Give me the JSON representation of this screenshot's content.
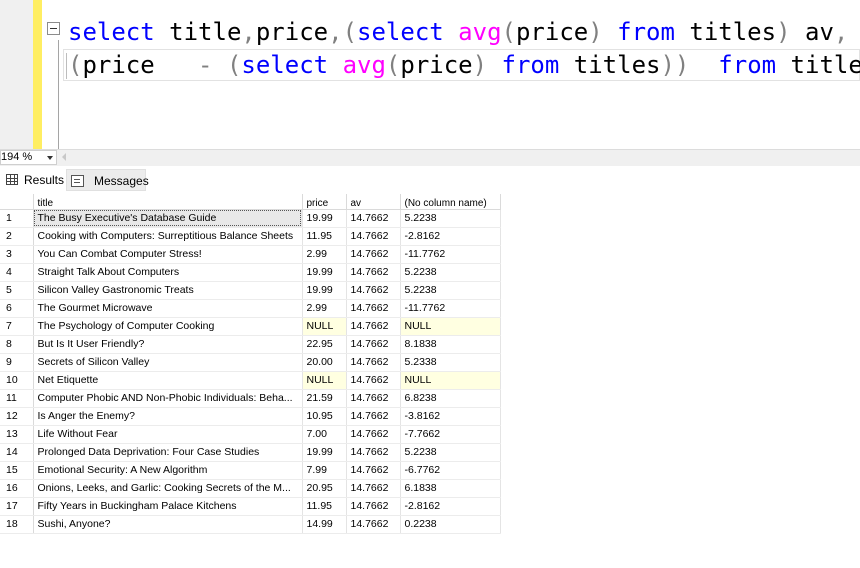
{
  "editor": {
    "line1": [
      {
        "t": "select",
        "c": "kw"
      },
      {
        "t": " title",
        "c": ""
      },
      {
        "t": ",",
        "c": "op"
      },
      {
        "t": "price",
        "c": ""
      },
      {
        "t": ",",
        "c": "op"
      },
      {
        "t": "(",
        "c": "op"
      },
      {
        "t": "select",
        "c": "kw"
      },
      {
        "t": " ",
        "c": ""
      },
      {
        "t": "avg",
        "c": "fn"
      },
      {
        "t": "(",
        "c": "op"
      },
      {
        "t": "price",
        "c": ""
      },
      {
        "t": ")",
        "c": "op"
      },
      {
        "t": " ",
        "c": ""
      },
      {
        "t": "from",
        "c": "kw"
      },
      {
        "t": " titles",
        "c": ""
      },
      {
        "t": ")",
        "c": "op"
      },
      {
        "t": " av",
        "c": ""
      },
      {
        "t": ",",
        "c": "op"
      }
    ],
    "line2": [
      {
        "t": "(",
        "c": "op"
      },
      {
        "t": "price   ",
        "c": ""
      },
      {
        "t": "-",
        "c": "op"
      },
      {
        "t": " ",
        "c": ""
      },
      {
        "t": "(",
        "c": "op"
      },
      {
        "t": "select",
        "c": "kw"
      },
      {
        "t": " ",
        "c": ""
      },
      {
        "t": "avg",
        "c": "fn"
      },
      {
        "t": "(",
        "c": "op"
      },
      {
        "t": "price",
        "c": ""
      },
      {
        "t": ")",
        "c": "op"
      },
      {
        "t": " ",
        "c": ""
      },
      {
        "t": "from",
        "c": "kw"
      },
      {
        "t": " titles",
        "c": ""
      },
      {
        "t": "))",
        "c": "op"
      },
      {
        "t": "  ",
        "c": ""
      },
      {
        "t": "from",
        "c": "kw"
      },
      {
        "t": " titles",
        "c": ""
      }
    ]
  },
  "zoom": {
    "value": "194 %"
  },
  "tabs": {
    "results": "Results",
    "messages": "Messages"
  },
  "grid": {
    "columns": [
      "title",
      "price",
      "av",
      "(No column name)"
    ],
    "rows": [
      [
        "1",
        "The Busy Executive's Database Guide",
        "19.99",
        "14.7662",
        "5.2238"
      ],
      [
        "2",
        "Cooking with Computers: Surreptitious Balance Sheets",
        "11.95",
        "14.7662",
        "-2.8162"
      ],
      [
        "3",
        "You Can Combat Computer Stress!",
        "2.99",
        "14.7662",
        "-11.7762"
      ],
      [
        "4",
        "Straight Talk About Computers",
        "19.99",
        "14.7662",
        "5.2238"
      ],
      [
        "5",
        "Silicon Valley Gastronomic Treats",
        "19.99",
        "14.7662",
        "5.2238"
      ],
      [
        "6",
        "The Gourmet Microwave",
        "2.99",
        "14.7662",
        "-11.7762"
      ],
      [
        "7",
        "The Psychology of Computer Cooking",
        "NULL",
        "14.7662",
        "NULL"
      ],
      [
        "8",
        "But Is It User Friendly?",
        "22.95",
        "14.7662",
        "8.1838"
      ],
      [
        "9",
        "Secrets of Silicon Valley",
        "20.00",
        "14.7662",
        "5.2338"
      ],
      [
        "10",
        "Net Etiquette",
        "NULL",
        "14.7662",
        "NULL"
      ],
      [
        "11",
        "Computer Phobic AND Non-Phobic Individuals: Beha...",
        "21.59",
        "14.7662",
        "6.8238"
      ],
      [
        "12",
        "Is Anger the Enemy?",
        "10.95",
        "14.7662",
        "-3.8162"
      ],
      [
        "13",
        "Life Without Fear",
        "7.00",
        "14.7662",
        "-7.7662"
      ],
      [
        "14",
        "Prolonged Data Deprivation: Four Case Studies",
        "19.99",
        "14.7662",
        "5.2238"
      ],
      [
        "15",
        "Emotional Security: A New Algorithm",
        "7.99",
        "14.7662",
        "-6.7762"
      ],
      [
        "16",
        "Onions, Leeks, and Garlic: Cooking Secrets of the M...",
        "20.95",
        "14.7662",
        "6.1838"
      ],
      [
        "17",
        "Fifty Years in Buckingham Palace Kitchens",
        "11.95",
        "14.7662",
        "-2.8162"
      ],
      [
        "18",
        "Sushi, Anyone?",
        "14.99",
        "14.7662",
        "0.2238"
      ]
    ]
  }
}
